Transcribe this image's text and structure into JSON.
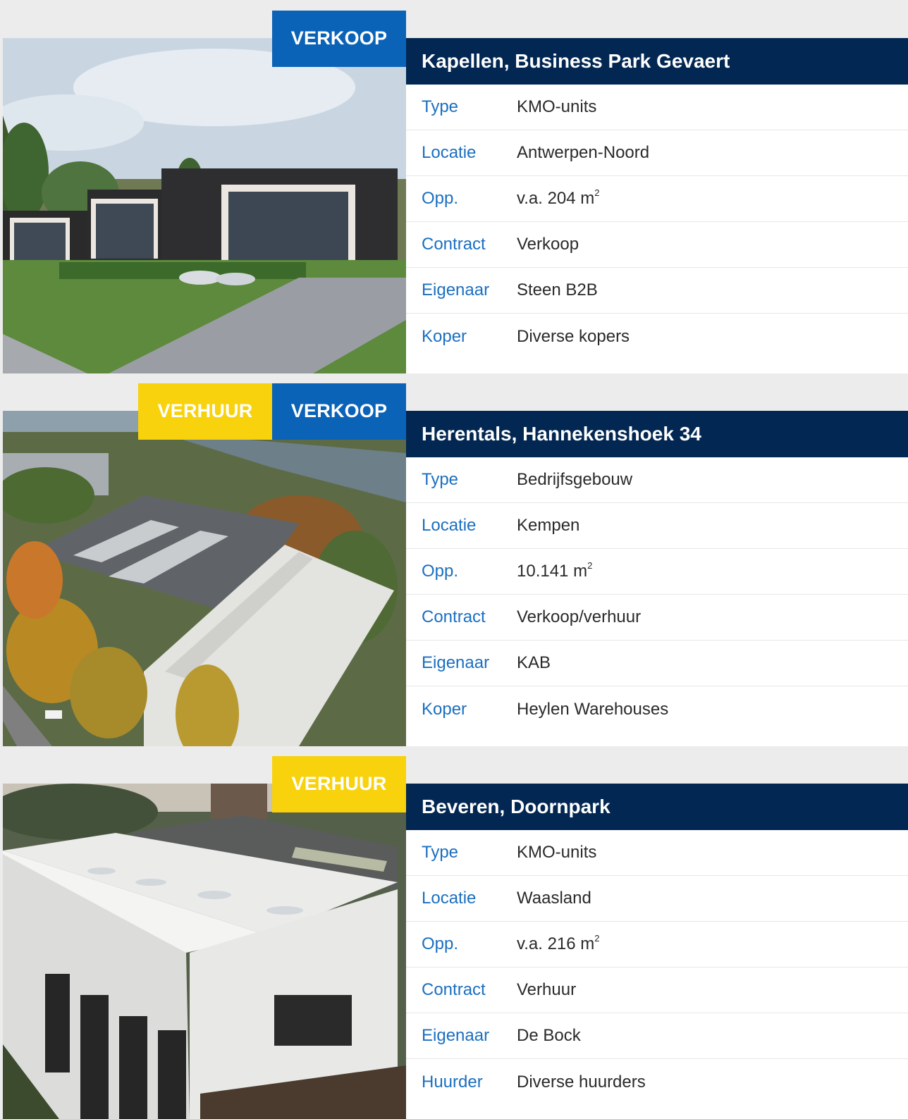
{
  "listings": [
    {
      "badges": [
        {
          "label": "VERKOOP",
          "color": "blue"
        }
      ],
      "title": "Kapellen, Business Park Gevaert",
      "rows": [
        {
          "key": "Type",
          "value": "KMO-units"
        },
        {
          "key": "Locatie",
          "value": "Antwerpen-Noord"
        },
        {
          "key": "Opp.",
          "value": "v.a. 204 m",
          "sup": "2"
        },
        {
          "key": "Contract",
          "value": "Verkoop"
        },
        {
          "key": "Eigenaar",
          "value": "Steen B2B"
        },
        {
          "key": "Koper",
          "value": "Diverse kopers"
        }
      ]
    },
    {
      "badges": [
        {
          "label": "VERHUUR",
          "color": "yellow"
        },
        {
          "label": "VERKOOP",
          "color": "blue"
        }
      ],
      "title": "Herentals, Hannekenshoek 34",
      "rows": [
        {
          "key": "Type",
          "value": "Bedrijfsgebouw"
        },
        {
          "key": "Locatie",
          "value": "Kempen"
        },
        {
          "key": "Opp.",
          "value": "10.141 m",
          "sup": "2"
        },
        {
          "key": "Contract",
          "value": "Verkoop/verhuur"
        },
        {
          "key": "Eigenaar",
          "value": "KAB"
        },
        {
          "key": "Koper",
          "value": "Heylen Warehouses"
        }
      ]
    },
    {
      "badges": [
        {
          "label": "VERHUUR",
          "color": "yellow"
        }
      ],
      "title": "Beveren, Doornpark",
      "rows": [
        {
          "key": "Type",
          "value": "KMO-units"
        },
        {
          "key": "Locatie",
          "value": "Waasland"
        },
        {
          "key": "Opp.",
          "value": "v.a. 216 m",
          "sup": "2"
        },
        {
          "key": "Contract",
          "value": "Verhuur"
        },
        {
          "key": "Eigenaar",
          "value": "De Bock"
        },
        {
          "key": "Huurder",
          "value": "Diverse huurders"
        }
      ]
    }
  ]
}
